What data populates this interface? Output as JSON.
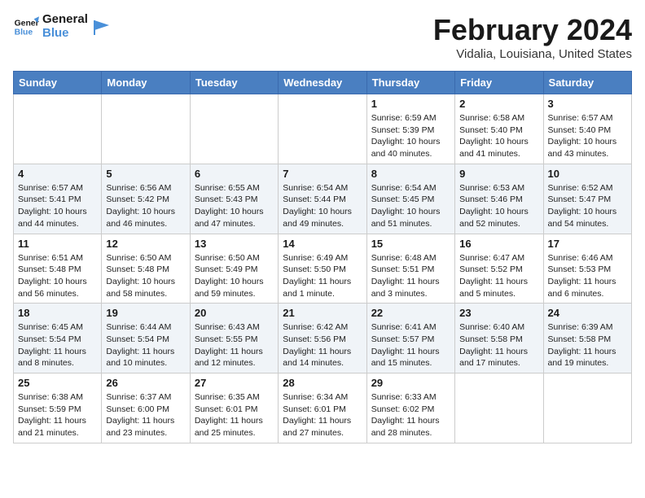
{
  "header": {
    "logo_general": "General",
    "logo_blue": "Blue",
    "month_title": "February 2024",
    "location": "Vidalia, Louisiana, United States"
  },
  "weekdays": [
    "Sunday",
    "Monday",
    "Tuesday",
    "Wednesday",
    "Thursday",
    "Friday",
    "Saturday"
  ],
  "weeks": [
    [
      {
        "day": "",
        "info": ""
      },
      {
        "day": "",
        "info": ""
      },
      {
        "day": "",
        "info": ""
      },
      {
        "day": "",
        "info": ""
      },
      {
        "day": "1",
        "info": "Sunrise: 6:59 AM\nSunset: 5:39 PM\nDaylight: 10 hours\nand 40 minutes."
      },
      {
        "day": "2",
        "info": "Sunrise: 6:58 AM\nSunset: 5:40 PM\nDaylight: 10 hours\nand 41 minutes."
      },
      {
        "day": "3",
        "info": "Sunrise: 6:57 AM\nSunset: 5:40 PM\nDaylight: 10 hours\nand 43 minutes."
      }
    ],
    [
      {
        "day": "4",
        "info": "Sunrise: 6:57 AM\nSunset: 5:41 PM\nDaylight: 10 hours\nand 44 minutes."
      },
      {
        "day": "5",
        "info": "Sunrise: 6:56 AM\nSunset: 5:42 PM\nDaylight: 10 hours\nand 46 minutes."
      },
      {
        "day": "6",
        "info": "Sunrise: 6:55 AM\nSunset: 5:43 PM\nDaylight: 10 hours\nand 47 minutes."
      },
      {
        "day": "7",
        "info": "Sunrise: 6:54 AM\nSunset: 5:44 PM\nDaylight: 10 hours\nand 49 minutes."
      },
      {
        "day": "8",
        "info": "Sunrise: 6:54 AM\nSunset: 5:45 PM\nDaylight: 10 hours\nand 51 minutes."
      },
      {
        "day": "9",
        "info": "Sunrise: 6:53 AM\nSunset: 5:46 PM\nDaylight: 10 hours\nand 52 minutes."
      },
      {
        "day": "10",
        "info": "Sunrise: 6:52 AM\nSunset: 5:47 PM\nDaylight: 10 hours\nand 54 minutes."
      }
    ],
    [
      {
        "day": "11",
        "info": "Sunrise: 6:51 AM\nSunset: 5:48 PM\nDaylight: 10 hours\nand 56 minutes."
      },
      {
        "day": "12",
        "info": "Sunrise: 6:50 AM\nSunset: 5:48 PM\nDaylight: 10 hours\nand 58 minutes."
      },
      {
        "day": "13",
        "info": "Sunrise: 6:50 AM\nSunset: 5:49 PM\nDaylight: 10 hours\nand 59 minutes."
      },
      {
        "day": "14",
        "info": "Sunrise: 6:49 AM\nSunset: 5:50 PM\nDaylight: 11 hours\nand 1 minute."
      },
      {
        "day": "15",
        "info": "Sunrise: 6:48 AM\nSunset: 5:51 PM\nDaylight: 11 hours\nand 3 minutes."
      },
      {
        "day": "16",
        "info": "Sunrise: 6:47 AM\nSunset: 5:52 PM\nDaylight: 11 hours\nand 5 minutes."
      },
      {
        "day": "17",
        "info": "Sunrise: 6:46 AM\nSunset: 5:53 PM\nDaylight: 11 hours\nand 6 minutes."
      }
    ],
    [
      {
        "day": "18",
        "info": "Sunrise: 6:45 AM\nSunset: 5:54 PM\nDaylight: 11 hours\nand 8 minutes."
      },
      {
        "day": "19",
        "info": "Sunrise: 6:44 AM\nSunset: 5:54 PM\nDaylight: 11 hours\nand 10 minutes."
      },
      {
        "day": "20",
        "info": "Sunrise: 6:43 AM\nSunset: 5:55 PM\nDaylight: 11 hours\nand 12 minutes."
      },
      {
        "day": "21",
        "info": "Sunrise: 6:42 AM\nSunset: 5:56 PM\nDaylight: 11 hours\nand 14 minutes."
      },
      {
        "day": "22",
        "info": "Sunrise: 6:41 AM\nSunset: 5:57 PM\nDaylight: 11 hours\nand 15 minutes."
      },
      {
        "day": "23",
        "info": "Sunrise: 6:40 AM\nSunset: 5:58 PM\nDaylight: 11 hours\nand 17 minutes."
      },
      {
        "day": "24",
        "info": "Sunrise: 6:39 AM\nSunset: 5:58 PM\nDaylight: 11 hours\nand 19 minutes."
      }
    ],
    [
      {
        "day": "25",
        "info": "Sunrise: 6:38 AM\nSunset: 5:59 PM\nDaylight: 11 hours\nand 21 minutes."
      },
      {
        "day": "26",
        "info": "Sunrise: 6:37 AM\nSunset: 6:00 PM\nDaylight: 11 hours\nand 23 minutes."
      },
      {
        "day": "27",
        "info": "Sunrise: 6:35 AM\nSunset: 6:01 PM\nDaylight: 11 hours\nand 25 minutes."
      },
      {
        "day": "28",
        "info": "Sunrise: 6:34 AM\nSunset: 6:01 PM\nDaylight: 11 hours\nand 27 minutes."
      },
      {
        "day": "29",
        "info": "Sunrise: 6:33 AM\nSunset: 6:02 PM\nDaylight: 11 hours\nand 28 minutes."
      },
      {
        "day": "",
        "info": ""
      },
      {
        "day": "",
        "info": ""
      }
    ]
  ]
}
